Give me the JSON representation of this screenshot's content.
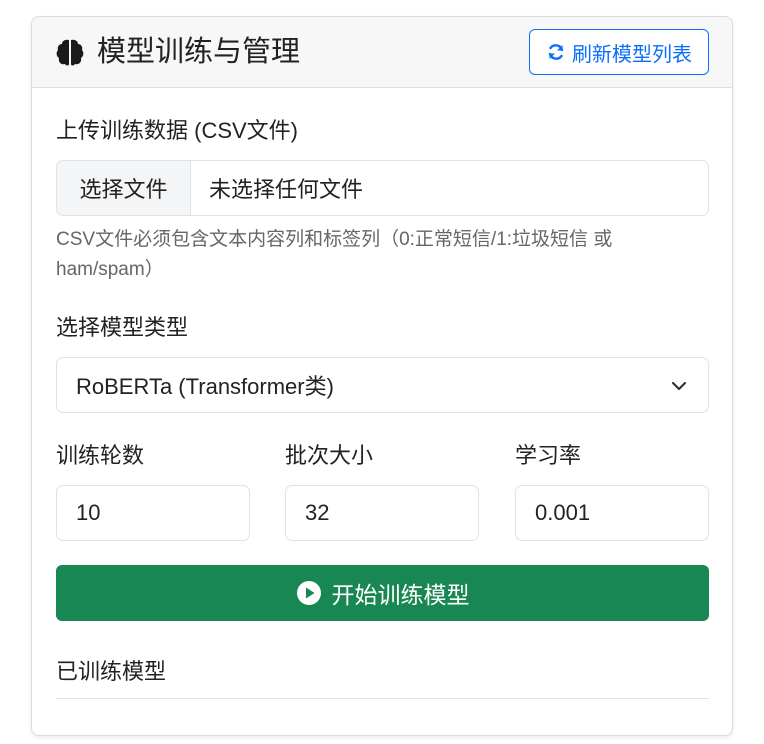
{
  "header": {
    "title": "模型训练与管理",
    "icon": "brain-icon",
    "refresh_label": "刷新模型列表",
    "refresh_icon": "refresh-icon"
  },
  "upload": {
    "label": "上传训练数据 (CSV文件)",
    "button_label": "选择文件",
    "file_status": "未选择任何文件",
    "help_text": "CSV文件必须包含文本内容列和标签列（0:正常短信/1:垃圾短信 或 ham/spam）"
  },
  "model_type": {
    "label": "选择模型类型",
    "selected": "RoBERTa (Transformer类)"
  },
  "params": {
    "epochs_label": "训练轮数",
    "epochs_value": "10",
    "batch_label": "批次大小",
    "batch_value": "32",
    "lr_label": "学习率",
    "lr_value": "0.001"
  },
  "train_button": {
    "label": "开始训练模型",
    "icon": "play-circle-icon"
  },
  "trained_models": {
    "label": "已训练模型"
  },
  "colors": {
    "primary": "#0d6efd",
    "success": "#198754"
  }
}
